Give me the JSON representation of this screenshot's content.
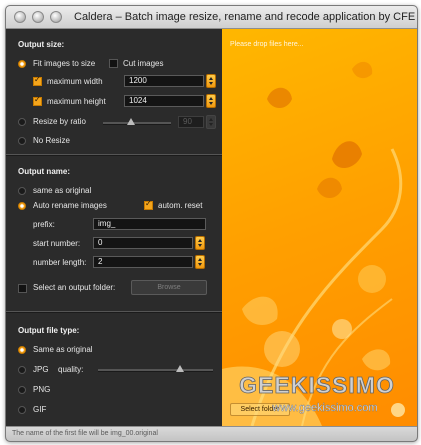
{
  "window": {
    "title": "Caldera – Batch image resize, rename and recode application by CFE"
  },
  "output_size": {
    "heading": "Output size:",
    "fit_images_label": "Fit images to size",
    "cut_images_label": "Cut images",
    "max_width_label": "maximum width",
    "max_width_value": "1200",
    "max_height_label": "maximum height",
    "max_height_value": "1024",
    "resize_by_ratio_label": "Resize by ratio",
    "ratio_value": "90",
    "no_resize_label": "No Resize"
  },
  "output_name": {
    "heading": "Output name:",
    "same_as_original_label": "same as original",
    "auto_rename_label": "Auto rename images",
    "autom_reset_label": "autom. reset",
    "prefix_label": "prefix:",
    "prefix_value": "img_",
    "start_number_label": "start number:",
    "start_number_value": "0",
    "number_length_label": "number length:",
    "number_length_value": "2",
    "output_folder_label": "Select an output folder:",
    "browse_label": "Browse"
  },
  "output_file_type": {
    "heading": "Output file type:",
    "same_as_original_label": "Same as original",
    "jpg_label": "JPG",
    "quality_label": "quality:",
    "png_label": "PNG",
    "gif_label": "GIF"
  },
  "drop_area": {
    "placeholder": "Please drop files here...",
    "select_folder_label": "Select folder"
  },
  "status_bar": {
    "text": "The name of the first file will be img_00.original"
  },
  "watermark": {
    "brand": "GEEKISSIMO",
    "url": "www.geekissimo.com"
  },
  "colors": {
    "accent": "#f4a51c",
    "panel": "#2b2b2b",
    "drop_bg": "#ffa200"
  }
}
